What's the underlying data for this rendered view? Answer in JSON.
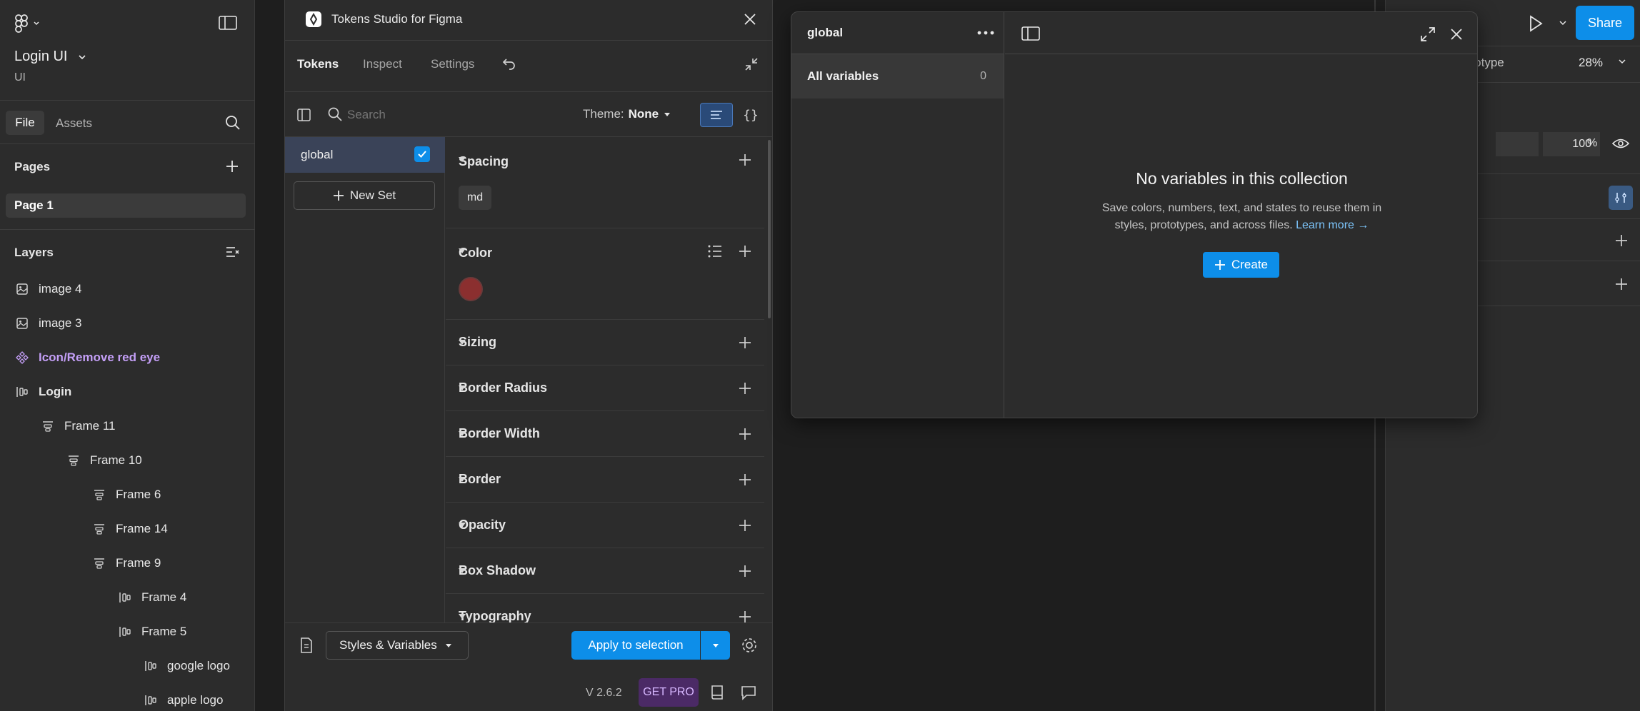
{
  "left_panel": {
    "file_name": "Login UI",
    "file_subtitle": "UI",
    "tabs": [
      "File",
      "Assets"
    ],
    "pages_header": "Pages",
    "pages": [
      "Page 1"
    ],
    "layers_header": "Layers",
    "layers": [
      {
        "name": "image 4",
        "icon": "image-icon",
        "indent": 0
      },
      {
        "name": "image 3",
        "icon": "image-icon",
        "indent": 0
      },
      {
        "name": "Icon/Remove red eye",
        "icon": "component-icon",
        "indent": 0
      },
      {
        "name": "Login",
        "icon": "frame-horizontal-icon",
        "indent": 0
      },
      {
        "name": "Frame 11",
        "icon": "frame-vertical-icon",
        "indent": 1
      },
      {
        "name": "Frame 10",
        "icon": "frame-vertical-icon",
        "indent": 2
      },
      {
        "name": "Frame 6",
        "icon": "frame-vertical-icon",
        "indent": 3
      },
      {
        "name": "Frame 14",
        "icon": "frame-vertical-icon",
        "indent": 3
      },
      {
        "name": "Frame 9",
        "icon": "frame-vertical-icon",
        "indent": 3
      },
      {
        "name": "Frame 4",
        "icon": "frame-horizontal-icon",
        "indent": 4
      },
      {
        "name": "Frame 5",
        "icon": "frame-horizontal-icon",
        "indent": 4
      },
      {
        "name": "google logo",
        "icon": "frame-horizontal-icon",
        "indent": 5
      },
      {
        "name": "apple logo",
        "icon": "frame-horizontal-icon",
        "indent": 5
      }
    ]
  },
  "plugin": {
    "title": "Tokens Studio for Figma",
    "tabs": [
      "Tokens",
      "Inspect",
      "Settings"
    ],
    "search_placeholder": "Search",
    "theme_label": "Theme:",
    "theme_value": "None",
    "sets": [
      {
        "name": "global",
        "checked": true
      }
    ],
    "new_set_label": "New Set",
    "sections": [
      "Spacing",
      "Color",
      "Sizing",
      "Border Radius",
      "Border Width",
      "Border",
      "Opacity",
      "Box Shadow",
      "Typography"
    ],
    "spacing_token": "md",
    "color_token_hex": "#8b2f2f",
    "styles_variables_label": "Styles & Variables",
    "apply_label": "Apply to selection",
    "version": "V 2.6.2",
    "get_pro_label": "GET PRO"
  },
  "variables_dialog": {
    "collection_name": "global",
    "all_variables_label": "All variables",
    "all_variables_count": "0",
    "empty_title": "No variables in this collection",
    "empty_line1": "Save colors, numbers, text, and states to reuse them in",
    "empty_line2": "styles, prototypes, and across files.",
    "learn_more": "Learn more →",
    "create_label": "Create"
  },
  "right_panel": {
    "share_label": "Share",
    "tab_fragment": "ototype",
    "zoom": "28%",
    "opacity_value": "100",
    "opacity_unit": "%"
  },
  "colors": {
    "accent_blue": "#0d8ee9",
    "panel_bg": "#2c2c2c",
    "canvas_bg": "#1e1e1e",
    "component_purple": "#c49ff7",
    "get_pro_bg": "#4b2a66",
    "get_pro_text": "#d7b7ff"
  }
}
